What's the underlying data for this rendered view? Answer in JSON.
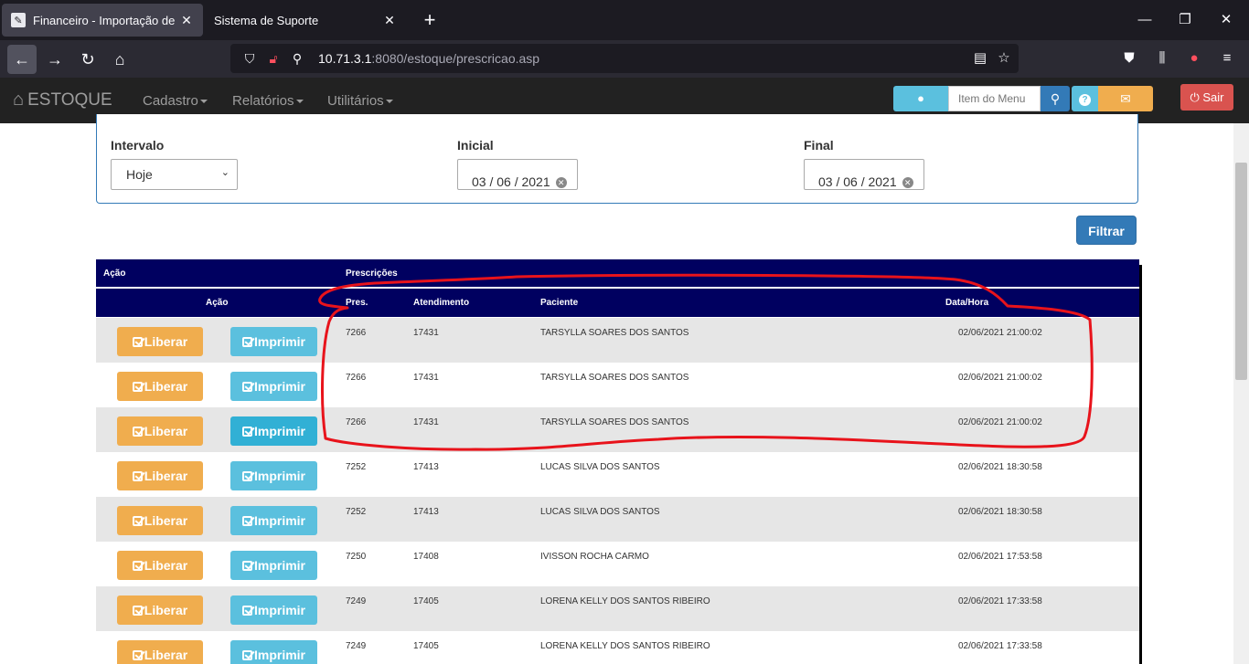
{
  "browser": {
    "tabs": [
      {
        "title": "Financeiro - Importação de Hor",
        "active": true
      },
      {
        "title": "Sistema de Suporte",
        "active": false
      }
    ],
    "url_host": "10.71.3.1",
    "url_path": ":8080/estoque/prescricao.asp"
  },
  "app": {
    "brand": "ESTOQUE",
    "menus": [
      "Cadastro",
      "Relatórios",
      "Utilitários"
    ],
    "search_placeholder": "Item do Menu",
    "exit_label": "Sair"
  },
  "filter": {
    "interval_label": "Intervalo",
    "interval_value": "Hoje",
    "start_label": "Inicial",
    "start_value": "03 / 06 / 2021",
    "end_label": "Final",
    "end_value": "03 / 06 / 2021",
    "filter_button": "Filtrar"
  },
  "grid": {
    "group_headers": {
      "action": "Ação",
      "prescriptions": "Prescrições"
    },
    "columns": {
      "action": "Ação",
      "pres": "Pres.",
      "atendimento": "Atendimento",
      "paciente": "Paciente",
      "datahora": "Data/Hora"
    },
    "release_label": "Liberar",
    "print_label": "Imprimir",
    "rows": [
      {
        "pres": "7266",
        "atendimento": "17431",
        "paciente": "TARSYLLA SOARES DOS SANTOS",
        "datahora": "02/06/2021 21:00:02"
      },
      {
        "pres": "7266",
        "atendimento": "17431",
        "paciente": "TARSYLLA SOARES DOS SANTOS",
        "datahora": "02/06/2021 21:00:02"
      },
      {
        "pres": "7266",
        "atendimento": "17431",
        "paciente": "TARSYLLA SOARES DOS SANTOS",
        "datahora": "02/06/2021 21:00:02"
      },
      {
        "pres": "7252",
        "atendimento": "17413",
        "paciente": "LUCAS SILVA DOS SANTOS",
        "datahora": "02/06/2021 18:30:58"
      },
      {
        "pres": "7252",
        "atendimento": "17413",
        "paciente": "LUCAS SILVA DOS SANTOS",
        "datahora": "02/06/2021 18:30:58"
      },
      {
        "pres": "7250",
        "atendimento": "17408",
        "paciente": "IVISSON ROCHA CARMO",
        "datahora": "02/06/2021 17:53:58"
      },
      {
        "pres": "7249",
        "atendimento": "17405",
        "paciente": "LORENA KELLY DOS SANTOS RIBEIRO",
        "datahora": "02/06/2021 17:33:58"
      },
      {
        "pres": "7249",
        "atendimento": "17405",
        "paciente": "LORENA KELLY DOS SANTOS RIBEIRO",
        "datahora": "02/06/2021 17:33:58"
      }
    ]
  },
  "colors": {
    "annotation": "#e8131b",
    "header": "#000060",
    "warning": "#f0ad4e",
    "info": "#5bc0de",
    "primary": "#337ab7"
  }
}
